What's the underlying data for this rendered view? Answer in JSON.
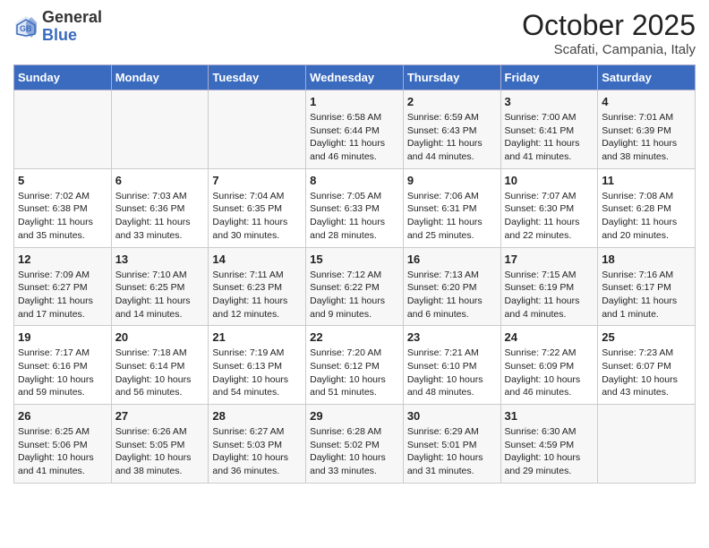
{
  "header": {
    "logo_general": "General",
    "logo_blue": "Blue",
    "month": "October 2025",
    "location": "Scafati, Campania, Italy"
  },
  "weekdays": [
    "Sunday",
    "Monday",
    "Tuesday",
    "Wednesday",
    "Thursday",
    "Friday",
    "Saturday"
  ],
  "weeks": [
    [
      {
        "day": "",
        "text": ""
      },
      {
        "day": "",
        "text": ""
      },
      {
        "day": "",
        "text": ""
      },
      {
        "day": "1",
        "text": "Sunrise: 6:58 AM\nSunset: 6:44 PM\nDaylight: 11 hours\nand 46 minutes."
      },
      {
        "day": "2",
        "text": "Sunrise: 6:59 AM\nSunset: 6:43 PM\nDaylight: 11 hours\nand 44 minutes."
      },
      {
        "day": "3",
        "text": "Sunrise: 7:00 AM\nSunset: 6:41 PM\nDaylight: 11 hours\nand 41 minutes."
      },
      {
        "day": "4",
        "text": "Sunrise: 7:01 AM\nSunset: 6:39 PM\nDaylight: 11 hours\nand 38 minutes."
      }
    ],
    [
      {
        "day": "5",
        "text": "Sunrise: 7:02 AM\nSunset: 6:38 PM\nDaylight: 11 hours\nand 35 minutes."
      },
      {
        "day": "6",
        "text": "Sunrise: 7:03 AM\nSunset: 6:36 PM\nDaylight: 11 hours\nand 33 minutes."
      },
      {
        "day": "7",
        "text": "Sunrise: 7:04 AM\nSunset: 6:35 PM\nDaylight: 11 hours\nand 30 minutes."
      },
      {
        "day": "8",
        "text": "Sunrise: 7:05 AM\nSunset: 6:33 PM\nDaylight: 11 hours\nand 28 minutes."
      },
      {
        "day": "9",
        "text": "Sunrise: 7:06 AM\nSunset: 6:31 PM\nDaylight: 11 hours\nand 25 minutes."
      },
      {
        "day": "10",
        "text": "Sunrise: 7:07 AM\nSunset: 6:30 PM\nDaylight: 11 hours\nand 22 minutes."
      },
      {
        "day": "11",
        "text": "Sunrise: 7:08 AM\nSunset: 6:28 PM\nDaylight: 11 hours\nand 20 minutes."
      }
    ],
    [
      {
        "day": "12",
        "text": "Sunrise: 7:09 AM\nSunset: 6:27 PM\nDaylight: 11 hours\nand 17 minutes."
      },
      {
        "day": "13",
        "text": "Sunrise: 7:10 AM\nSunset: 6:25 PM\nDaylight: 11 hours\nand 14 minutes."
      },
      {
        "day": "14",
        "text": "Sunrise: 7:11 AM\nSunset: 6:23 PM\nDaylight: 11 hours\nand 12 minutes."
      },
      {
        "day": "15",
        "text": "Sunrise: 7:12 AM\nSunset: 6:22 PM\nDaylight: 11 hours\nand 9 minutes."
      },
      {
        "day": "16",
        "text": "Sunrise: 7:13 AM\nSunset: 6:20 PM\nDaylight: 11 hours\nand 6 minutes."
      },
      {
        "day": "17",
        "text": "Sunrise: 7:15 AM\nSunset: 6:19 PM\nDaylight: 11 hours\nand 4 minutes."
      },
      {
        "day": "18",
        "text": "Sunrise: 7:16 AM\nSunset: 6:17 PM\nDaylight: 11 hours\nand 1 minute."
      }
    ],
    [
      {
        "day": "19",
        "text": "Sunrise: 7:17 AM\nSunset: 6:16 PM\nDaylight: 10 hours\nand 59 minutes."
      },
      {
        "day": "20",
        "text": "Sunrise: 7:18 AM\nSunset: 6:14 PM\nDaylight: 10 hours\nand 56 minutes."
      },
      {
        "day": "21",
        "text": "Sunrise: 7:19 AM\nSunset: 6:13 PM\nDaylight: 10 hours\nand 54 minutes."
      },
      {
        "day": "22",
        "text": "Sunrise: 7:20 AM\nSunset: 6:12 PM\nDaylight: 10 hours\nand 51 minutes."
      },
      {
        "day": "23",
        "text": "Sunrise: 7:21 AM\nSunset: 6:10 PM\nDaylight: 10 hours\nand 48 minutes."
      },
      {
        "day": "24",
        "text": "Sunrise: 7:22 AM\nSunset: 6:09 PM\nDaylight: 10 hours\nand 46 minutes."
      },
      {
        "day": "25",
        "text": "Sunrise: 7:23 AM\nSunset: 6:07 PM\nDaylight: 10 hours\nand 43 minutes."
      }
    ],
    [
      {
        "day": "26",
        "text": "Sunrise: 6:25 AM\nSunset: 5:06 PM\nDaylight: 10 hours\nand 41 minutes."
      },
      {
        "day": "27",
        "text": "Sunrise: 6:26 AM\nSunset: 5:05 PM\nDaylight: 10 hours\nand 38 minutes."
      },
      {
        "day": "28",
        "text": "Sunrise: 6:27 AM\nSunset: 5:03 PM\nDaylight: 10 hours\nand 36 minutes."
      },
      {
        "day": "29",
        "text": "Sunrise: 6:28 AM\nSunset: 5:02 PM\nDaylight: 10 hours\nand 33 minutes."
      },
      {
        "day": "30",
        "text": "Sunrise: 6:29 AM\nSunset: 5:01 PM\nDaylight: 10 hours\nand 31 minutes."
      },
      {
        "day": "31",
        "text": "Sunrise: 6:30 AM\nSunset: 4:59 PM\nDaylight: 10 hours\nand 29 minutes."
      },
      {
        "day": "",
        "text": ""
      }
    ]
  ]
}
